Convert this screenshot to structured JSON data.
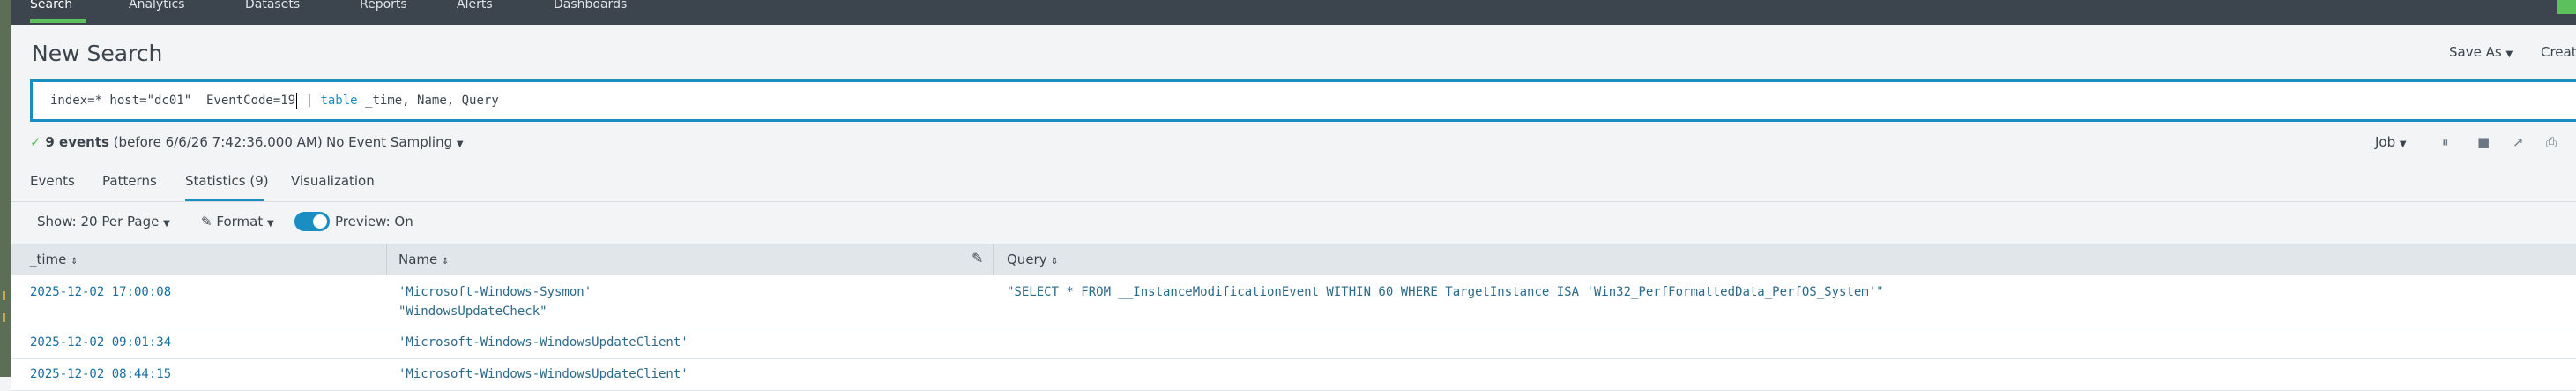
{
  "nav": {
    "items": [
      "Search",
      "Analytics",
      "Datasets",
      "Reports",
      "Alerts",
      "Dashboards"
    ],
    "active_index": 0
  },
  "page": {
    "title": "New Search",
    "save_as": "Save As",
    "create": "Creat"
  },
  "search": {
    "query_prefix": "index=* host=\"dc01\"  EventCode=19",
    "query_pipe": " | ",
    "query_command": "table",
    "query_suffix": " _time, Name, Query"
  },
  "results_meta": {
    "count": "9 events",
    "before": "(before 6/6/26 7:42:36.000 AM)",
    "sampling": "No Event Sampling",
    "job": "Job"
  },
  "tabs": [
    "Events",
    "Patterns",
    "Statistics (9)",
    "Visualization"
  ],
  "active_tab": 2,
  "toolbar": {
    "show": "Show: 20 Per Page",
    "format": "Format",
    "preview": "Preview: On"
  },
  "table": {
    "columns": [
      "_time",
      "Name",
      "Query"
    ],
    "rows": [
      {
        "time": "2025-12-02 17:00:08",
        "name": [
          "'Microsoft-Windows-Sysmon'",
          "\"WindowsUpdateCheck\""
        ],
        "query": "\"SELECT * FROM __InstanceModificationEvent WITHIN 60 WHERE TargetInstance ISA 'Win32_PerfFormattedData_PerfOS_System'\""
      },
      {
        "time": "2025-12-02 09:01:34",
        "name": [
          "'Microsoft-Windows-WindowsUpdateClient'"
        ],
        "query": ""
      },
      {
        "time": "2025-12-02 08:44:15",
        "name": [
          "'Microsoft-Windows-WindowsUpdateClient'"
        ],
        "query": ""
      }
    ]
  },
  "colors": {
    "nav_bg": "#3c444d",
    "accent": "#1a8dc3",
    "success": "#5cc05c"
  }
}
